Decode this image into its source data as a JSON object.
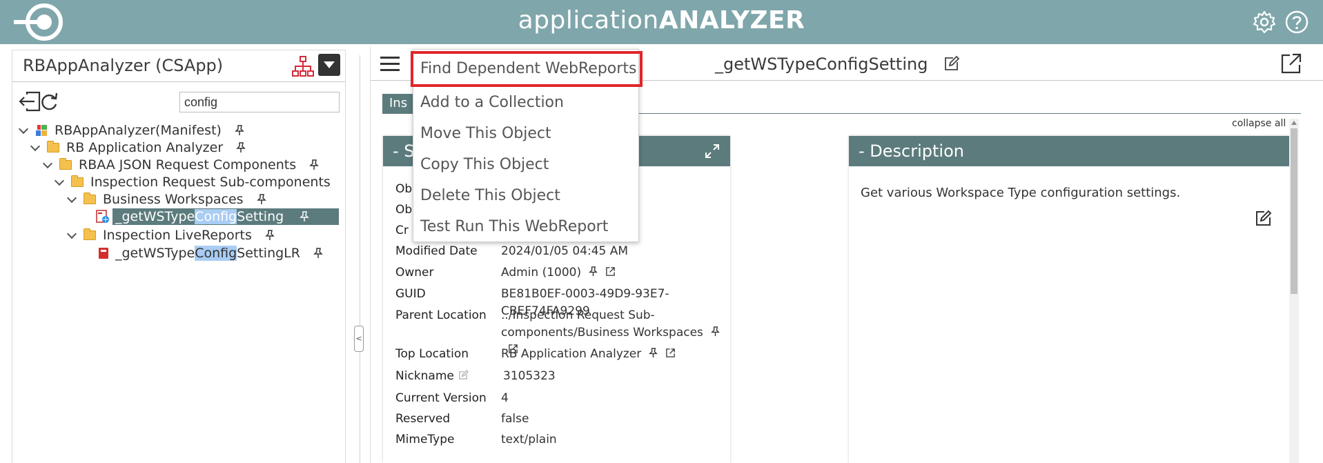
{
  "header": {
    "title_light": "application",
    "title_bold": "ANALYZER",
    "logo_icon": "target-logo-icon",
    "settings_icon": "gear-icon",
    "help_icon": "help-circle-icon",
    "background_color": "#7fa6ab"
  },
  "left_panel": {
    "title": "RBAppAnalyzer (CSApp)",
    "tree_icon": "sitemap-icon",
    "dropdown_icon": "caret-down-icon",
    "toolbar": [
      "exit-icon",
      "refresh-icon"
    ],
    "filter_value": "config",
    "tree": [
      {
        "label": "RBAppAnalyzer(Manifest)",
        "type": "manifest"
      },
      {
        "label": "RB Application Analyzer",
        "type": "folder"
      },
      {
        "label": "RBAA JSON Request Components",
        "type": "folder"
      },
      {
        "label": "Inspection Request Sub-components",
        "type": "folder"
      },
      {
        "label": "Business Workspaces",
        "type": "folder"
      },
      {
        "label_pre": "_getWSType",
        "label_match": "Config",
        "label_post": "Setting",
        "type": "webreport",
        "selected": true
      },
      {
        "label": "Inspection LiveReports",
        "type": "folder"
      },
      {
        "label_pre": "_getWSType",
        "label_match": "Config",
        "label_post": "SettingLR",
        "type": "livereport"
      }
    ]
  },
  "divider": {
    "handle_label": "<"
  },
  "main": {
    "object_title": "_getWSTypeConfigSetting",
    "tab_label": "Ins",
    "collapse_all": "collapse all",
    "accent_color": "#5c7b7c",
    "summary_card": {
      "title": "- S",
      "rows": [
        {
          "label": "Ob",
          "value": ""
        },
        {
          "label": "Ob",
          "value": ""
        },
        {
          "label": "Cr",
          "value": ""
        },
        {
          "label": "Modified Date",
          "value": "2024/01/05 04:45 AM"
        },
        {
          "label": "Owner",
          "value": "Admin (1000)"
        },
        {
          "label": "GUID",
          "value": "BE81B0EF-0003-49D9-93E7-CBEF74FA9299"
        },
        {
          "label": "Parent Location",
          "value": "../Inspection Request Sub-components/Business Workspaces"
        },
        {
          "label": "Top Location",
          "value": "RB Application Analyzer"
        },
        {
          "label": "Nickname",
          "value": "3105323"
        },
        {
          "label": "Current Version",
          "value": "4"
        },
        {
          "label": "Reserved",
          "value": "false"
        },
        {
          "label": "MimeType",
          "value": "text/plain"
        }
      ]
    },
    "description_card": {
      "title": "- Description",
      "text": "Get various Workspace Type configuration settings."
    }
  },
  "context_menu": {
    "items": [
      "Find Dependent WebReports",
      "Add to a Collection",
      "Move This Object",
      "Copy This Object",
      "Delete This Object",
      "Test Run This WebReport"
    ],
    "highlight_color": "#e0262a"
  }
}
